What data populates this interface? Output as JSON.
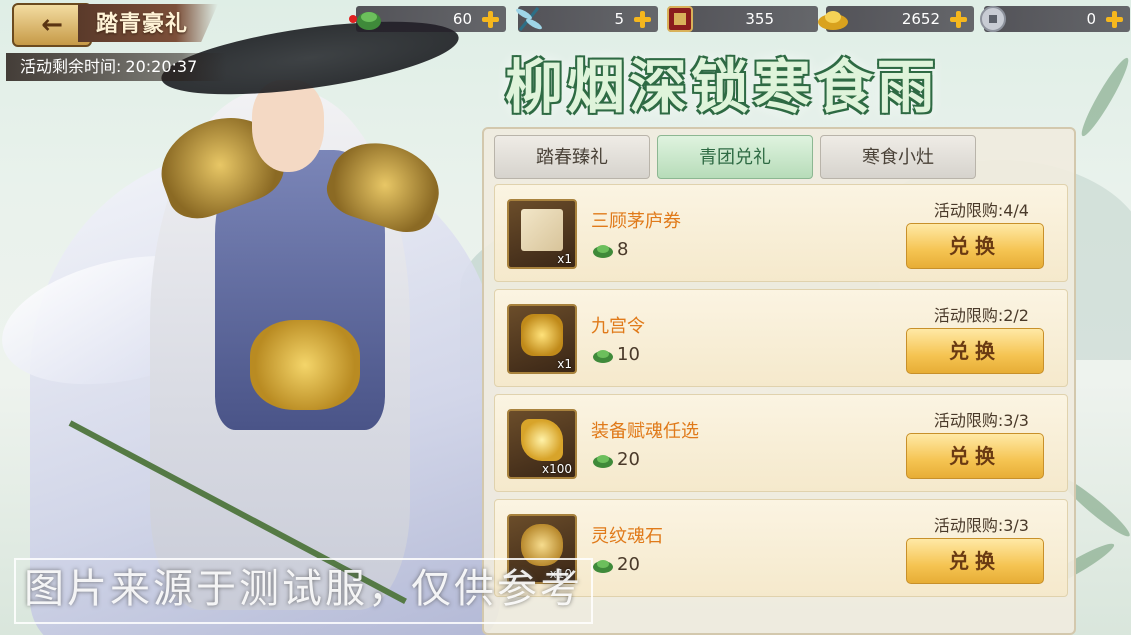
{
  "header": {
    "title": "踏青豪礼",
    "timer_label": "活动剩余时间:",
    "timer_value": "20:20:37"
  },
  "currencies": [
    {
      "icon": "green-dumpling-icon",
      "value": "60"
    },
    {
      "icon": "dragonfly-icon",
      "value": "5"
    },
    {
      "icon": "battle-token-icon",
      "value": "355"
    },
    {
      "icon": "gold-ingot-icon",
      "value": "2652"
    },
    {
      "icon": "copper-coin-icon",
      "value": "0"
    }
  ],
  "banner": {
    "text": "柳烟深锁寒食雨"
  },
  "tabs": [
    {
      "label": "踏春臻礼",
      "active": false
    },
    {
      "label": "青团兑礼",
      "active": true
    },
    {
      "label": "寒食小灶",
      "active": false
    }
  ],
  "items": [
    {
      "name": "三顾茅庐券",
      "quantity": "x1",
      "price": "8",
      "limit": "活动限购:4/4",
      "button": "兑换",
      "icon": "scroll-map-icon"
    },
    {
      "name": "九宫令",
      "quantity": "x1",
      "price": "10",
      "limit": "活动限购:2/2",
      "button": "兑换",
      "icon": "gold-token-icon"
    },
    {
      "name": "装备赋魂任选",
      "quantity": "x100",
      "price": "20",
      "limit": "活动限购:3/3",
      "button": "兑换",
      "icon": "soul-armor-icon"
    },
    {
      "name": "灵纹魂石",
      "quantity": "x10",
      "price": "20",
      "limit": "活动限购:3/3",
      "button": "兑换",
      "icon": "rune-stone-icon"
    }
  ],
  "price_icon": "green-dumpling-icon",
  "watermark": "图片来源于测试服，仅供参考",
  "colors": {
    "accent_orange": "#e07a1a",
    "button_gold": "#f5c452",
    "tab_active": "#b7dcb9",
    "banner_green": "#2f6b44"
  }
}
